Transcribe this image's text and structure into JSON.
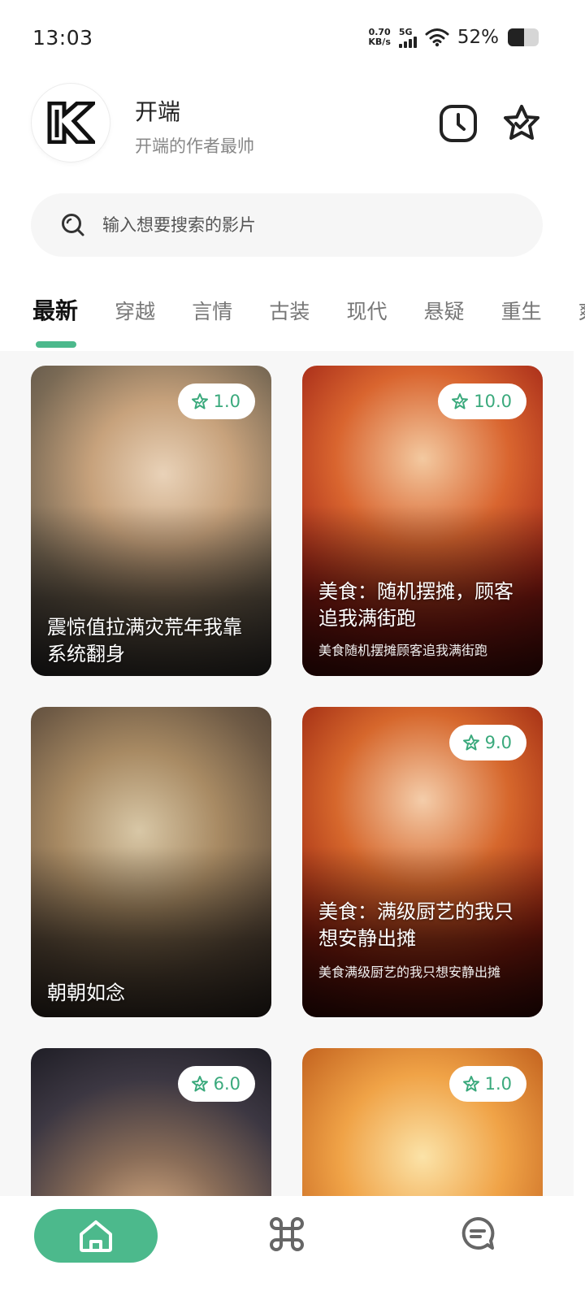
{
  "status": {
    "time": "13:03",
    "speed_value": "0.70",
    "speed_unit": "KB/s",
    "network": "5G",
    "battery": "52%"
  },
  "header": {
    "logo_icon": "k-logo-icon",
    "title": "开端",
    "subtitle": "开端的作者最帅",
    "history_icon": "clock-icon",
    "favorite_icon": "star-badge-icon"
  },
  "search": {
    "placeholder": "输入想要搜索的影片"
  },
  "tabs": [
    "最新",
    "穿越",
    "言情",
    "古装",
    "现代",
    "悬疑",
    "重生",
    "爽"
  ],
  "accent_color": "#4cb98c",
  "cards": [
    {
      "rating": "1.0",
      "title": "震惊值拉满灾荒年我靠系统翻身",
      "desc": ""
    },
    {
      "rating": "10.0",
      "title": "美食：随机摆摊，顾客追我满街跑",
      "desc": "美食随机摆摊顾客追我满街跑"
    },
    {
      "rating": "",
      "title": "朝朝如念",
      "desc": ""
    },
    {
      "rating": "9.0",
      "title": "美食：满级厨艺的我只想安静出摊",
      "desc": "美食满级厨艺的我只想安静出摊"
    },
    {
      "rating": "6.0",
      "title": "",
      "desc": ""
    },
    {
      "rating": "1.0",
      "title": "",
      "desc": ""
    }
  ],
  "bottom_nav": {
    "home_icon": "home-icon",
    "category_icon": "category-icon",
    "message_icon": "chat-icon"
  }
}
